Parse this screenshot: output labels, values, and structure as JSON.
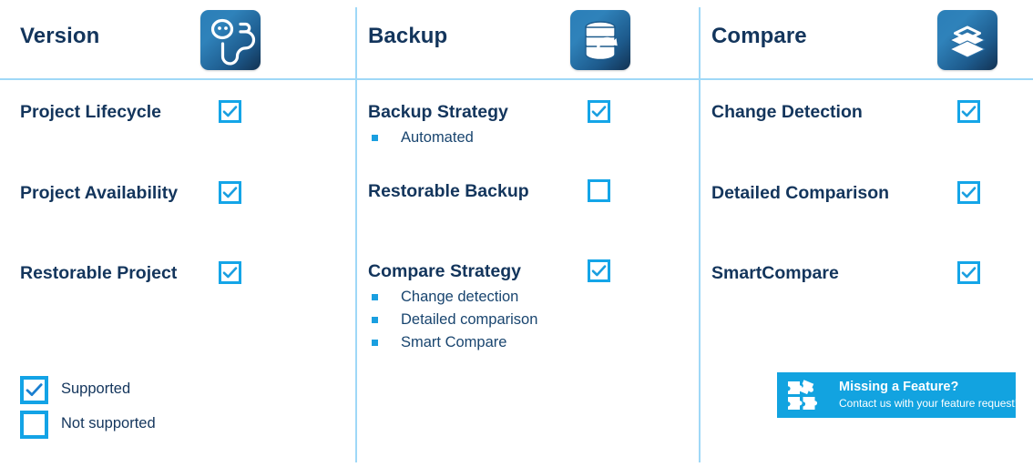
{
  "columns": [
    {
      "title": "Version",
      "icon": "version-branch-icon",
      "rows": [
        {
          "label": "Project Lifecycle",
          "checked": true,
          "sub": []
        },
        {
          "label": "Project Availability",
          "checked": true,
          "sub": []
        },
        {
          "label": "Restorable Project",
          "checked": true,
          "sub": []
        }
      ]
    },
    {
      "title": "Backup",
      "icon": "database-restore-icon",
      "rows": [
        {
          "label": "Backup Strategy",
          "checked": true,
          "sub": [
            "Automated"
          ]
        },
        {
          "label": "Restorable Backup",
          "checked": false,
          "sub": []
        },
        {
          "label": "Compare Strategy",
          "checked": true,
          "sub": [
            "Change detection",
            "Detailed comparison",
            "Smart Compare"
          ]
        }
      ]
    },
    {
      "title": "Compare",
      "icon": "layers-stack-icon",
      "rows": [
        {
          "label": "Change Detection",
          "checked": true,
          "sub": []
        },
        {
          "label": "Detailed Comparison",
          "checked": true,
          "sub": []
        },
        {
          "label": "SmartCompare",
          "checked": true,
          "sub": []
        }
      ]
    }
  ],
  "legend": [
    {
      "label": "Supported",
      "checked": true
    },
    {
      "label": "Not supported",
      "checked": false
    }
  ],
  "banner": {
    "title": "Missing a Feature?",
    "subtitle": "Contact us with your feature request!",
    "icon": "puzzle-pieces-icon",
    "background": "#12a3e0"
  },
  "colors": {
    "heading": "#13355c",
    "checkbox_border": "#14a5e8",
    "check_mark": "#1a9fe0",
    "divider": "#9fd8f7",
    "bullet": "#1a9fe0",
    "icon_tile_gradient_from": "#2f82ba",
    "icon_tile_gradient_to": "#123252"
  }
}
